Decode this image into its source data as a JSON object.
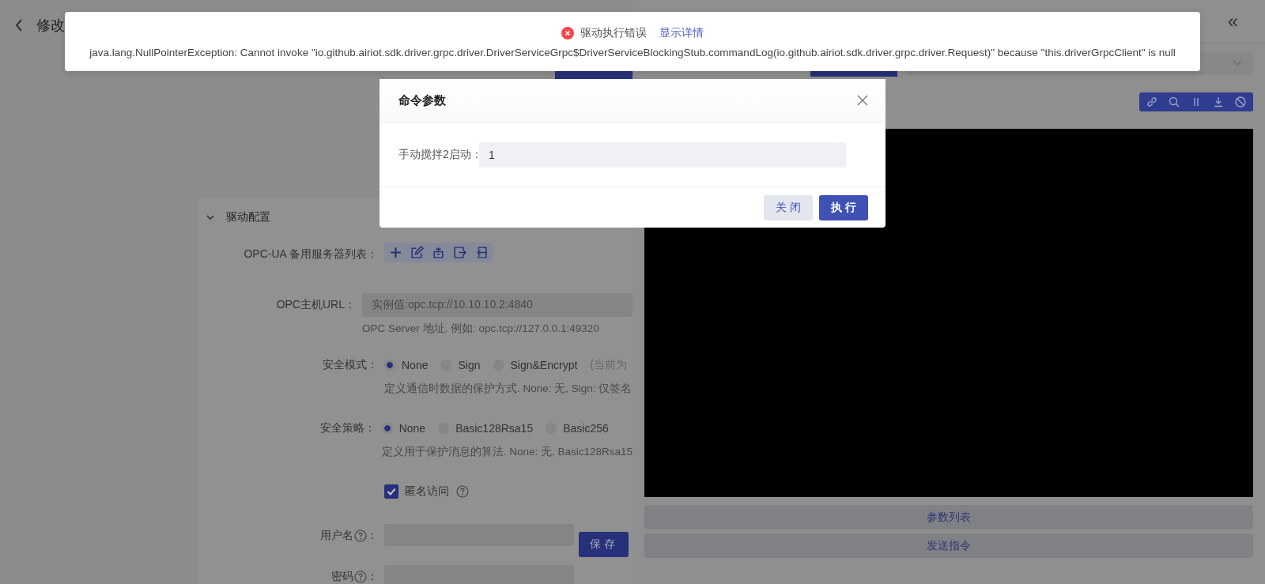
{
  "page": {
    "title": "修改",
    "section": {
      "title": "驱动配置",
      "expanded": true,
      "fields": [
        {
          "kind": "toolbar",
          "label": "OPC-UA 备用服务器列表："
        },
        {
          "kind": "input",
          "label": "OPC主机URL：",
          "placeholder": "实例值:opc.tcp://10.10.10.2:4840",
          "hint": "OPC Server 地址. 例如: opc.tcp://127.0.0.1:49320"
        },
        {
          "kind": "radio",
          "label": "安全模式：",
          "options": [
            {
              "label": "None",
              "selected": true
            },
            {
              "label": "Sign",
              "selected": false
            },
            {
              "label": "Sign&Encrypt",
              "selected": false
            }
          ],
          "note": "(当前为",
          "hint": "定义通信时数据的保护方式. None: 无, Sign: 仅签名"
        },
        {
          "kind": "radio",
          "label": "安全策略：",
          "options": [
            {
              "label": "None",
              "selected": true
            },
            {
              "label": "Basic128Rsa15",
              "selected": false
            },
            {
              "label": "Basic256",
              "selected": false
            }
          ],
          "hint": "定义用于保护消息的算法. None: 无, Basic128Rsa15"
        },
        {
          "kind": "checkbox",
          "label": "匿名访问",
          "checked": true
        },
        {
          "kind": "input",
          "label": "用户名",
          "help": true,
          "suffix": "："
        },
        {
          "kind": "input",
          "label": "密码",
          "help": true,
          "suffix": "："
        }
      ]
    },
    "save_button": "保存"
  },
  "drawer": {
    "collapse_icon": "«",
    "buttons": [
      "参数列表",
      "发送指令"
    ]
  },
  "modal": {
    "title": "命令参数",
    "field": {
      "label": "手动搅拌2启动：",
      "value": "1"
    },
    "buttons": [
      {
        "label": "关 闭",
        "kind": "secondary"
      },
      {
        "label": "执 行",
        "kind": "primary"
      }
    ]
  },
  "notification": {
    "title": "驱动执行错误",
    "link": "显示详情",
    "message": "java.lang.NullPointerException: Cannot invoke \"io.github.airiot.sdk.driver.grpc.driver.DriverServiceGrpc$DriverServiceBlockingStub.commandLog(io.github.airiot.sdk.driver.grpc.driver.Request)\" because \"this.driverGrpcClient\" is null"
  }
}
